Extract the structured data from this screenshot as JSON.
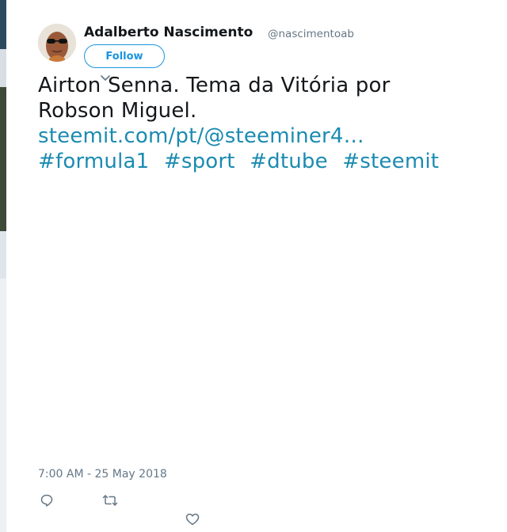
{
  "tweet": {
    "author": {
      "name": "Adalberto Nascimento",
      "handle": "@nascimentoab"
    },
    "follow_label": "Follow",
    "text": {
      "line1": "Airton Senna. Tema da Vitória  por",
      "line2": "Robson Miguel.",
      "link": "steemit.com/pt/@steeminer4…",
      "hashtags": [
        "#formula1",
        "#sport",
        "#dtube",
        "#steemit"
      ]
    },
    "timestamp": "7:00 AM - 25 May 2018",
    "actions": {
      "reply_icon": "reply-icon",
      "retweet_icon": "retweet-icon",
      "like_icon": "heart-icon"
    }
  },
  "colors": {
    "link": "#1b8bb1",
    "follow": "#1b95e0",
    "muted": "#657786",
    "text": "#14171a"
  }
}
